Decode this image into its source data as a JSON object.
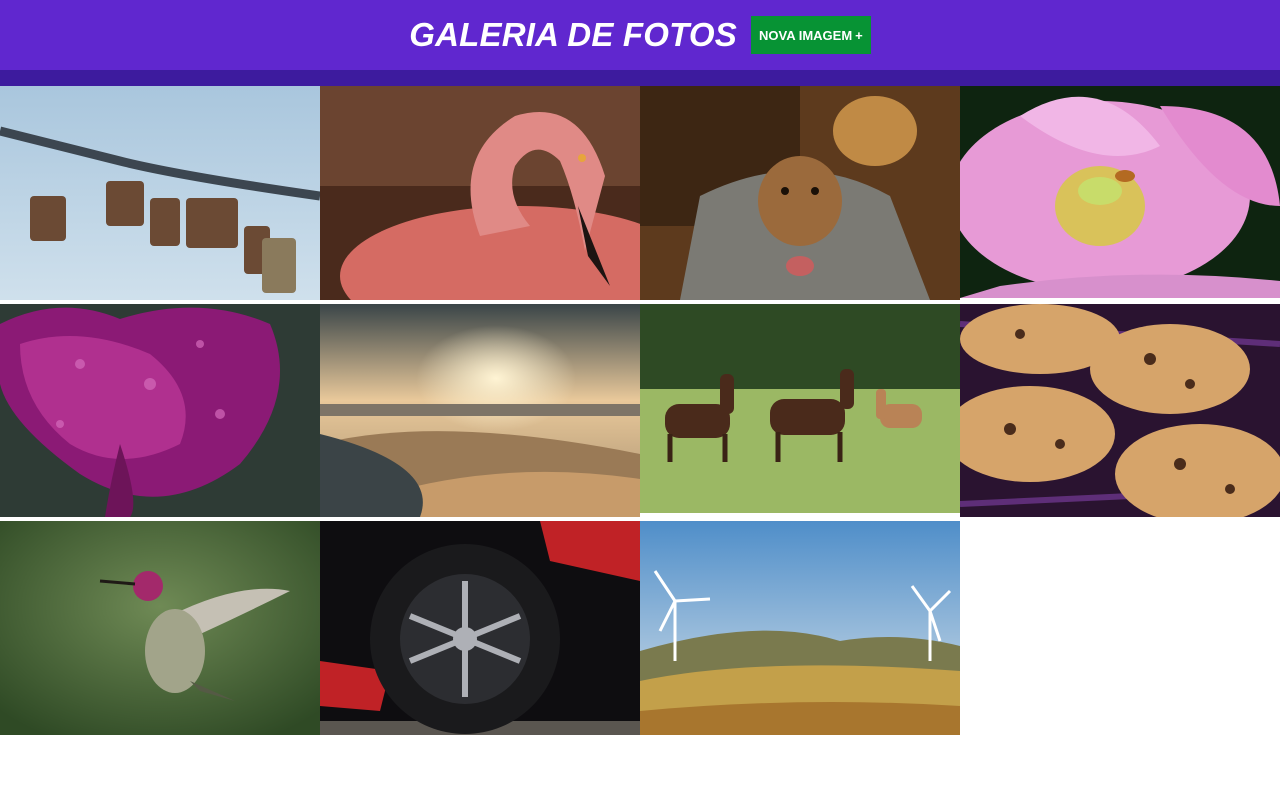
{
  "header": {
    "title": "GALERIA DE FOTOS",
    "new_button_label": "NOVA IMAGEM",
    "new_button_icon": "plus-icon",
    "new_button_icon_glyph": "+"
  },
  "colors": {
    "header_bg": "#6027cf",
    "header_band": "#3d1b9e",
    "button_bg": "#079334"
  },
  "gallery": {
    "images": [
      {
        "subject": "padlocks-on-chain"
      },
      {
        "subject": "flamingo"
      },
      {
        "subject": "puppies-in-bag"
      },
      {
        "subject": "lotus-flower-with-bee"
      },
      {
        "subject": "wet-purple-rose"
      },
      {
        "subject": "desert-sunset"
      },
      {
        "subject": "horses-in-field"
      },
      {
        "subject": "chocolate-chip-cookies"
      },
      {
        "subject": "hummingbird"
      },
      {
        "subject": "car-wheel"
      },
      {
        "subject": "wind-turbines-hills"
      }
    ]
  }
}
